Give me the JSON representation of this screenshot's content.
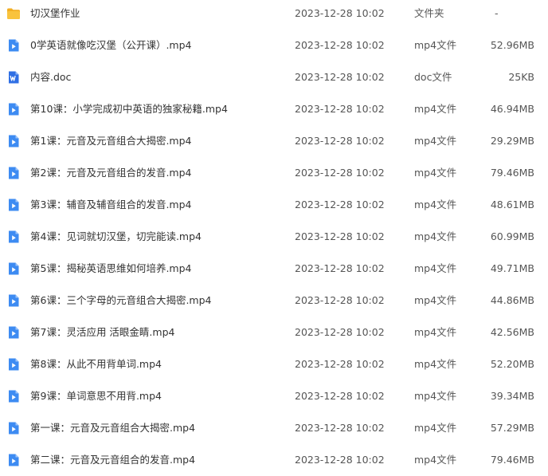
{
  "files": [
    {
      "icon": "folder-icon",
      "name": "切汉堡作业",
      "date": "2023-12-28 10:02",
      "type": "文件夹",
      "size": "-"
    },
    {
      "icon": "video-file-icon",
      "name": "0学英语就像吃汉堡（公开课）.mp4",
      "date": "2023-12-28 10:02",
      "type": "mp4文件",
      "size": "52.96MB"
    },
    {
      "icon": "word-doc-icon",
      "name": "内容.doc",
      "date": "2023-12-28 10:02",
      "type": "doc文件",
      "size": "25KB"
    },
    {
      "icon": "video-file-icon",
      "name": "第10课：小学完成初中英语的独家秘籍.mp4",
      "date": "2023-12-28 10:02",
      "type": "mp4文件",
      "size": "46.94MB"
    },
    {
      "icon": "video-file-icon",
      "name": "第1课：元音及元音组合大揭密.mp4",
      "date": "2023-12-28 10:02",
      "type": "mp4文件",
      "size": "29.29MB"
    },
    {
      "icon": "video-file-icon",
      "name": "第2课：元音及元音组合的发音.mp4",
      "date": "2023-12-28 10:02",
      "type": "mp4文件",
      "size": "79.46MB"
    },
    {
      "icon": "video-file-icon",
      "name": "第3课：辅音及辅音组合的发音.mp4",
      "date": "2023-12-28 10:02",
      "type": "mp4文件",
      "size": "48.61MB"
    },
    {
      "icon": "video-file-icon",
      "name": "第4课：见词就切汉堡，切完能读.mp4",
      "date": "2023-12-28 10:02",
      "type": "mp4文件",
      "size": "60.99MB"
    },
    {
      "icon": "video-file-icon",
      "name": "第5课：揭秘英语思维如何培养.mp4",
      "date": "2023-12-28 10:02",
      "type": "mp4文件",
      "size": "49.71MB"
    },
    {
      "icon": "video-file-icon",
      "name": "第6课：三个字母的元音组合大揭密.mp4",
      "date": "2023-12-28 10:02",
      "type": "mp4文件",
      "size": "44.86MB"
    },
    {
      "icon": "video-file-icon",
      "name": "第7课：灵活应用 活眼金睛.mp4",
      "date": "2023-12-28 10:02",
      "type": "mp4文件",
      "size": "42.56MB"
    },
    {
      "icon": "video-file-icon",
      "name": "第8课：从此不用背单词.mp4",
      "date": "2023-12-28 10:02",
      "type": "mp4文件",
      "size": "52.20MB"
    },
    {
      "icon": "video-file-icon",
      "name": "第9课：单词意思不用背.mp4",
      "date": "2023-12-28 10:02",
      "type": "mp4文件",
      "size": "39.34MB"
    },
    {
      "icon": "video-file-icon",
      "name": "第一课：元音及元音组合大揭密.mp4",
      "date": "2023-12-28 10:02",
      "type": "mp4文件",
      "size": "57.29MB"
    },
    {
      "icon": "video-file-icon",
      "name": "第二课：元音及元音组合的发音.mp4",
      "date": "2023-12-28 10:02",
      "type": "mp4文件",
      "size": "79.46MB"
    }
  ],
  "colors": {
    "folder": "#F9C33D",
    "folder_tab": "#F2AE22",
    "video": "#3D8BF2",
    "word": "#2F6FE4",
    "text": "#333333",
    "meta_text": "#555555"
  }
}
